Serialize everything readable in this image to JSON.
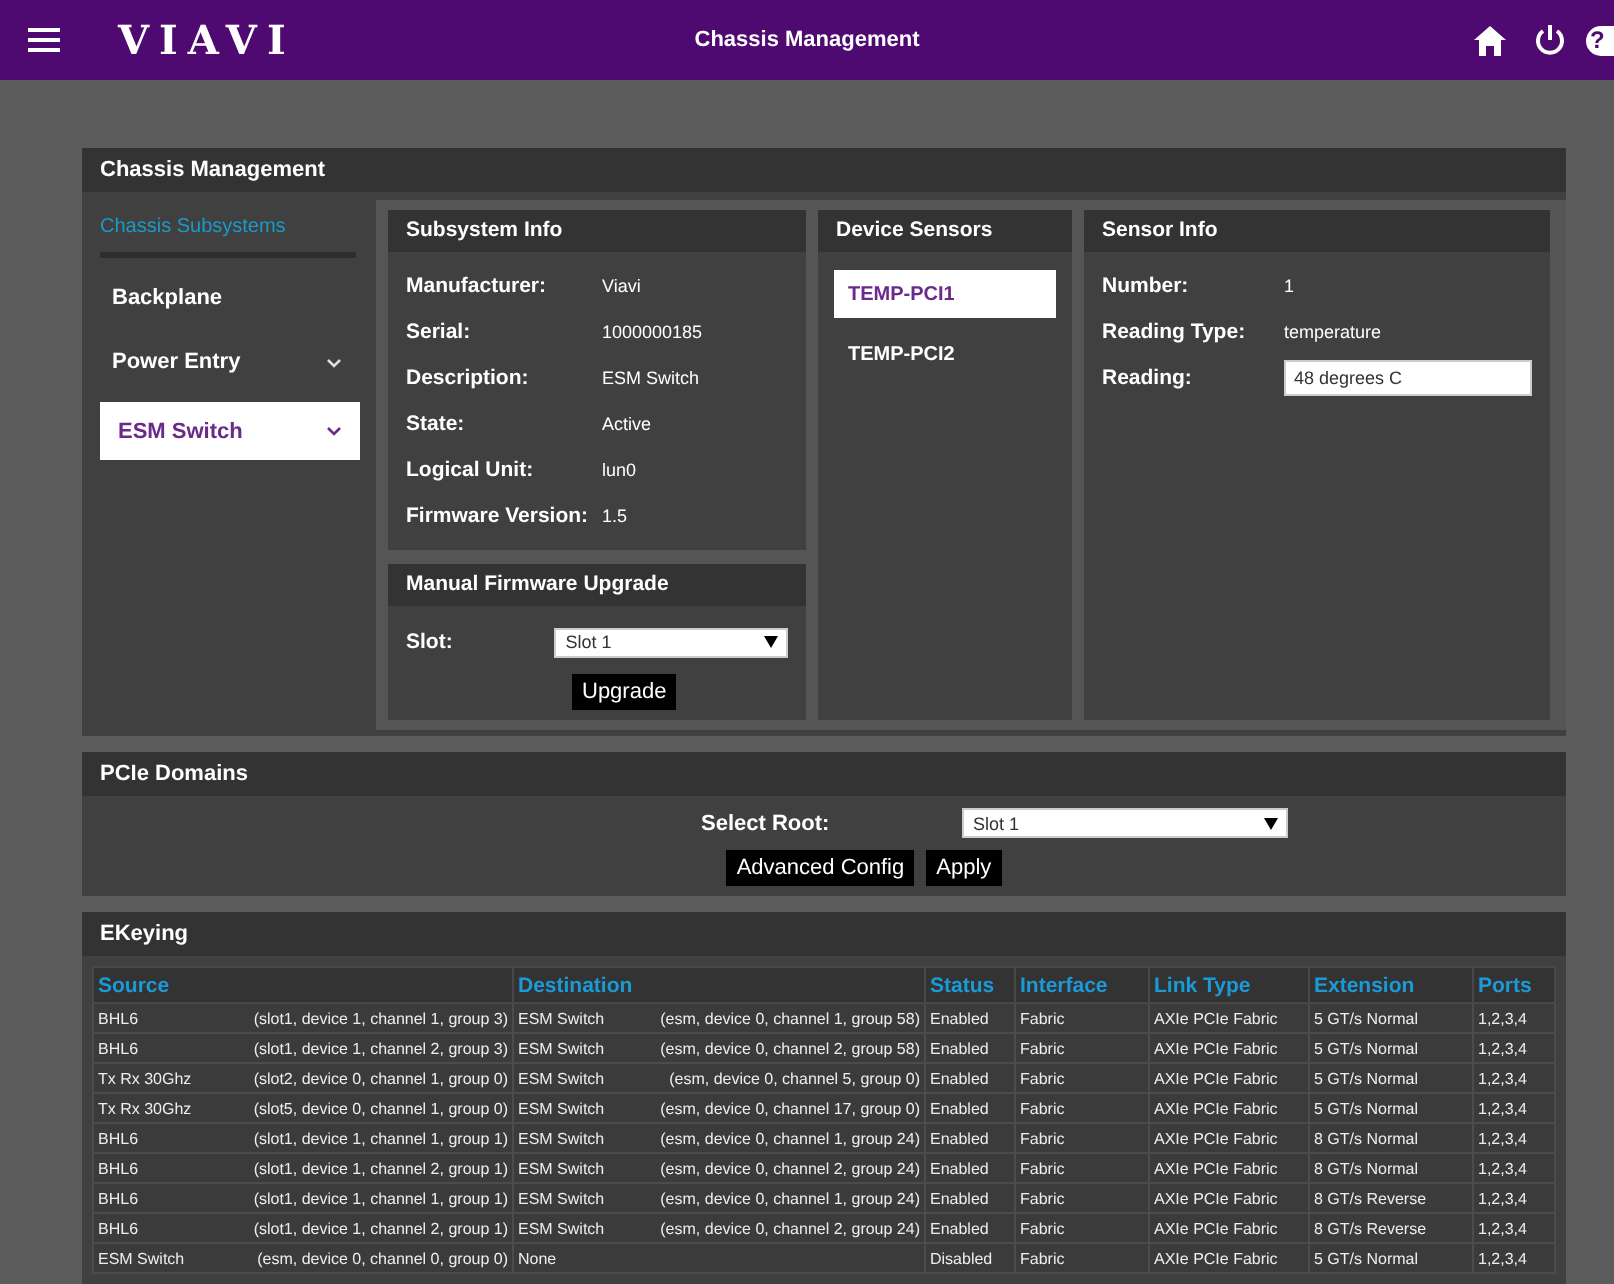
{
  "top_bar": {
    "logo": "VIAVI",
    "title": "Chassis Management",
    "help_label": "?"
  },
  "chassis": {
    "title": "Chassis Management",
    "nav_heading": "Chassis Subsystems",
    "nav_items": [
      {
        "label": "Backplane",
        "expandable": false,
        "selected": false
      },
      {
        "label": "Power Entry",
        "expandable": true,
        "selected": false
      },
      {
        "label": "ESM Switch",
        "expandable": true,
        "selected": true
      }
    ],
    "subsystem_info": {
      "title": "Subsystem Info",
      "fields": [
        {
          "label": "Manufacturer:",
          "value": "Viavi"
        },
        {
          "label": "Serial:",
          "value": "1000000185"
        },
        {
          "label": "Description:",
          "value": "ESM Switch"
        },
        {
          "label": "State:",
          "value": "Active"
        },
        {
          "label": "Logical Unit:",
          "value": "lun0"
        },
        {
          "label": "Firmware Version:",
          "value": "1.5"
        }
      ]
    },
    "firmware_upgrade": {
      "title": "Manual Firmware Upgrade",
      "slot_label": "Slot:",
      "slot_value": "Slot 1",
      "button": "Upgrade"
    },
    "device_sensors": {
      "title": "Device Sensors",
      "items": [
        {
          "label": "TEMP-PCI1",
          "selected": true
        },
        {
          "label": "TEMP-PCI2",
          "selected": false
        }
      ]
    },
    "sensor_info": {
      "title": "Sensor Info",
      "fields": [
        {
          "label": "Number:",
          "value": "1",
          "kind": "text"
        },
        {
          "label": "Reading Type:",
          "value": "temperature",
          "kind": "text"
        },
        {
          "label": "Reading:",
          "value": "48 degrees C",
          "kind": "field"
        }
      ]
    }
  },
  "pcie_domains": {
    "title": "PCIe Domains",
    "root_label": "Select Root:",
    "root_value": "Slot 1",
    "buttons": [
      "Advanced Config",
      "Apply"
    ]
  },
  "ekeying": {
    "title": "EKeying",
    "columns": [
      "Source",
      "Destination",
      "Status",
      "Interface",
      "Link Type",
      "Extension",
      "Ports"
    ],
    "rows": [
      {
        "source": "BHL6",
        "source_address": "(slot1, device 1, channel 1, group 3)",
        "destination": "ESM Switch",
        "destination_address": "(esm, device 0, channel 1, group 58)",
        "status": "Enabled",
        "interface": "Fabric",
        "link_type": "AXIe PCIe Fabric",
        "extension": "5 GT/s Normal",
        "ports": "1,2,3,4"
      },
      {
        "source": "BHL6",
        "source_address": "(slot1, device 1, channel 2, group 3)",
        "destination": "ESM Switch",
        "destination_address": "(esm, device 0, channel 2, group 58)",
        "status": "Enabled",
        "interface": "Fabric",
        "link_type": "AXIe PCIe Fabric",
        "extension": "5 GT/s Normal",
        "ports": "1,2,3,4"
      },
      {
        "source": "Tx Rx 30Ghz",
        "source_address": "(slot2, device 0, channel 1, group 0)",
        "destination": "ESM Switch",
        "destination_address": "(esm, device 0, channel 5, group 0)",
        "status": "Enabled",
        "interface": "Fabric",
        "link_type": "AXIe PCIe Fabric",
        "extension": "5 GT/s Normal",
        "ports": "1,2,3,4"
      },
      {
        "source": "Tx Rx 30Ghz",
        "source_address": "(slot5, device 0, channel 1, group 0)",
        "destination": "ESM Switch",
        "destination_address": "(esm, device 0, channel 17, group 0)",
        "status": "Enabled",
        "interface": "Fabric",
        "link_type": "AXIe PCIe Fabric",
        "extension": "5 GT/s Normal",
        "ports": "1,2,3,4"
      },
      {
        "source": "BHL6",
        "source_address": "(slot1, device 1, channel 1, group 1)",
        "destination": "ESM Switch",
        "destination_address": "(esm, device 0, channel 1, group 24)",
        "status": "Enabled",
        "interface": "Fabric",
        "link_type": "AXIe PCIe Fabric",
        "extension": "8 GT/s Normal",
        "ports": "1,2,3,4"
      },
      {
        "source": "BHL6",
        "source_address": "(slot1, device 1, channel 2, group 1)",
        "destination": "ESM Switch",
        "destination_address": "(esm, device 0, channel 2, group 24)",
        "status": "Enabled",
        "interface": "Fabric",
        "link_type": "AXIe PCIe Fabric",
        "extension": "8 GT/s Normal",
        "ports": "1,2,3,4"
      },
      {
        "source": "BHL6",
        "source_address": "(slot1, device 1, channel 1, group 1)",
        "destination": "ESM Switch",
        "destination_address": "(esm, device 0, channel 1, group 24)",
        "status": "Enabled",
        "interface": "Fabric",
        "link_type": "AXIe PCIe Fabric",
        "extension": "8 GT/s Reverse",
        "ports": "1,2,3,4"
      },
      {
        "source": "BHL6",
        "source_address": "(slot1, device 1, channel 2, group 1)",
        "destination": "ESM Switch",
        "destination_address": "(esm, device 0, channel 2, group 24)",
        "status": "Enabled",
        "interface": "Fabric",
        "link_type": "AXIe PCIe Fabric",
        "extension": "8 GT/s Reverse",
        "ports": "1,2,3,4"
      },
      {
        "source": "ESM Switch",
        "source_address": "(esm, device 0, channel 0, group 0)",
        "destination": "None",
        "status": "Disabled",
        "interface": "Fabric",
        "link_type": "AXIe PCIe Fabric",
        "extension": "5 GT/s Normal",
        "ports": "1,2,3,4"
      }
    ]
  }
}
